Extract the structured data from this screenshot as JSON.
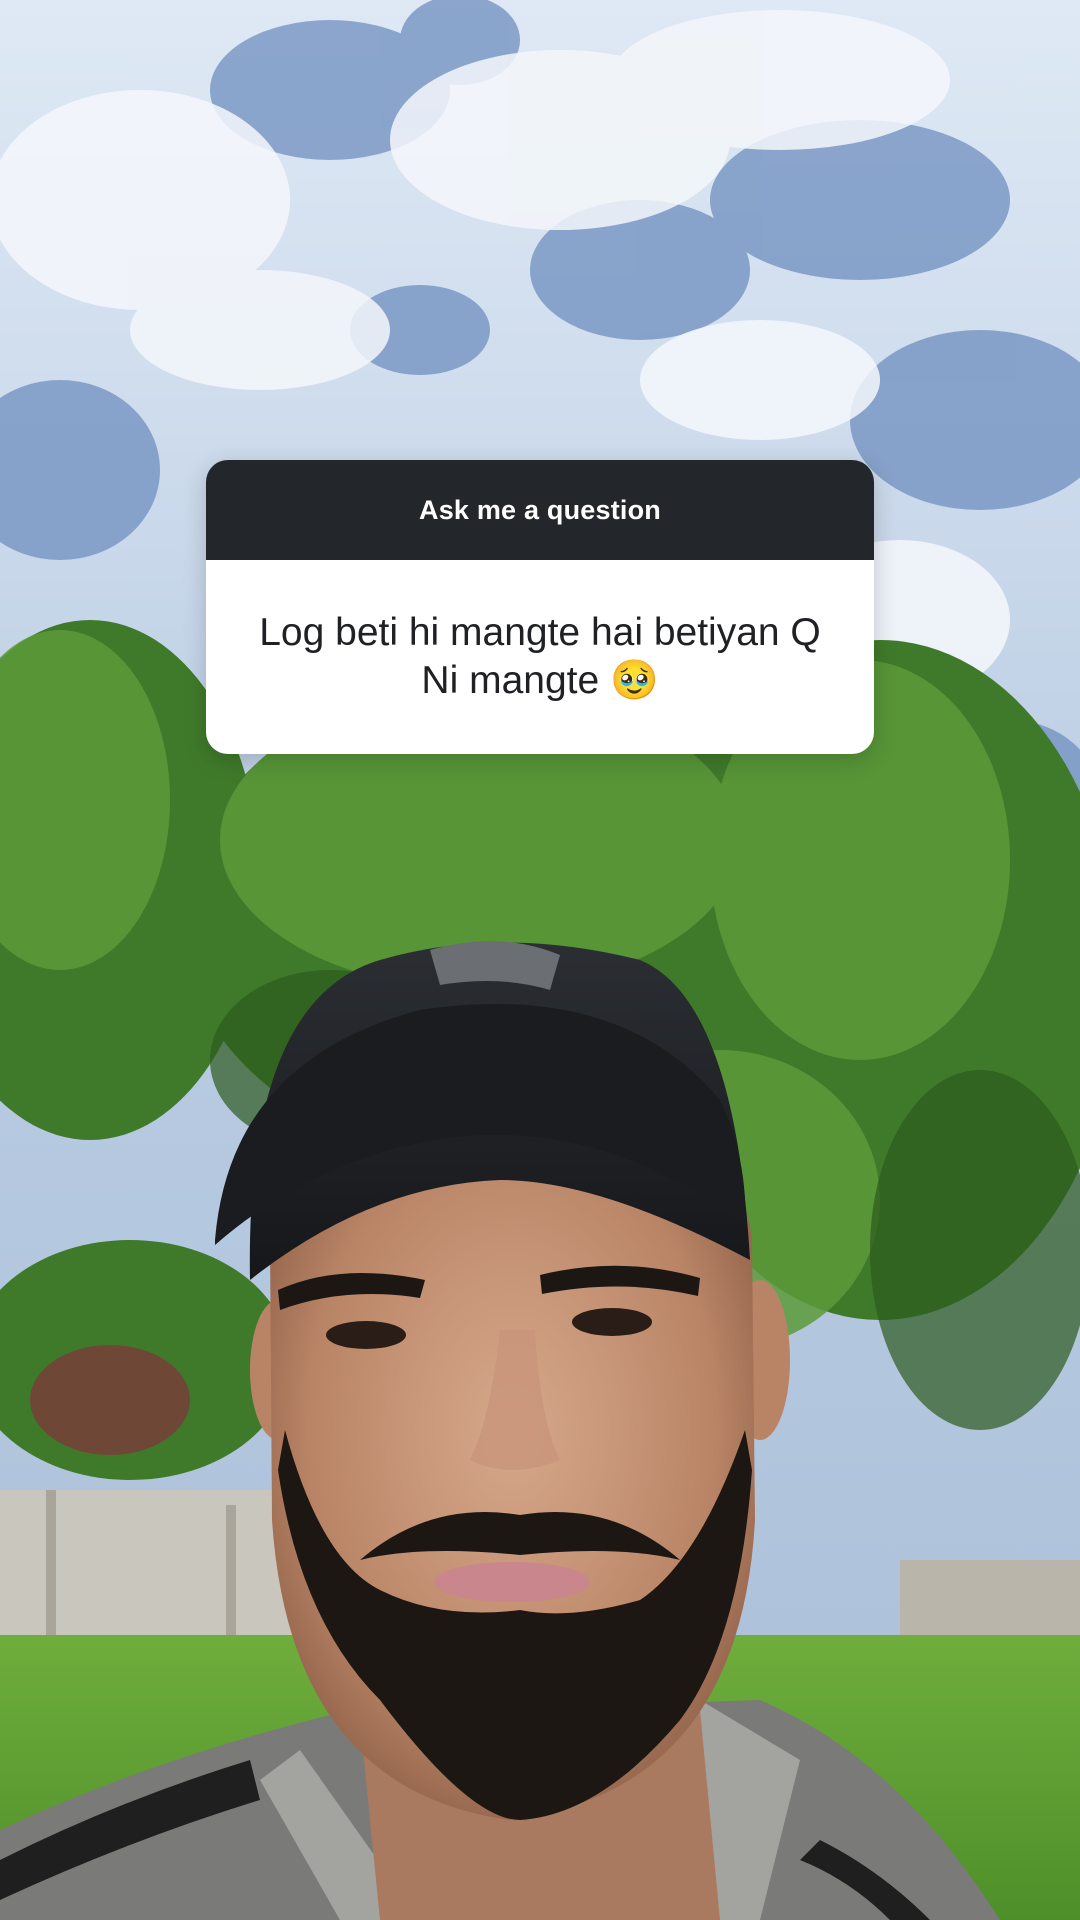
{
  "question_sticker": {
    "header": "Ask me a question",
    "text": "Log beti hi mangte hai betiyan Q Ni mangte 🥹"
  },
  "colors": {
    "sticker_header_bg": "#23272b",
    "sticker_body_bg": "#ffffff",
    "sticker_header_text": "#ffffff",
    "sticker_body_text": "#202124"
  }
}
